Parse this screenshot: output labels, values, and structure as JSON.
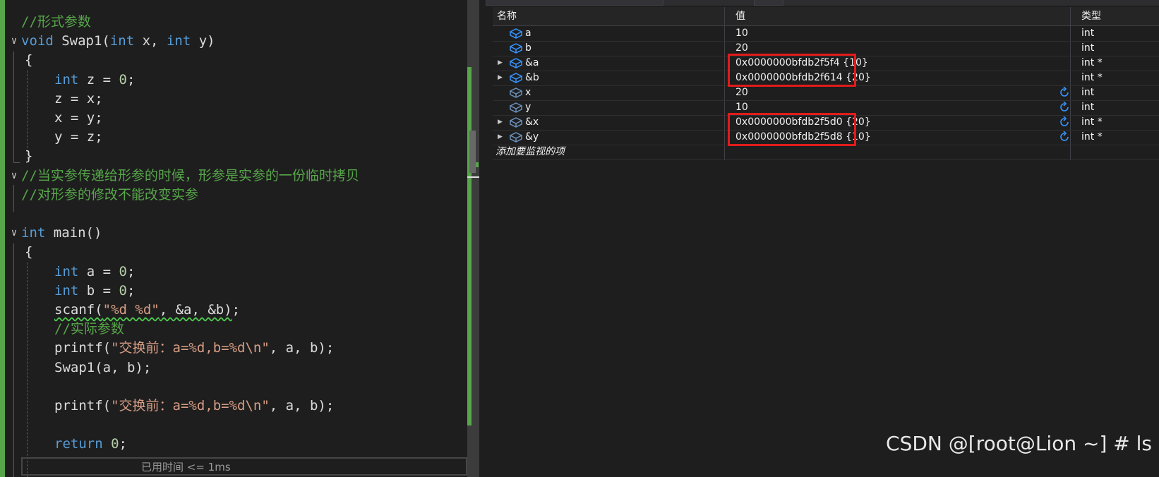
{
  "editor": {
    "lines": [
      {
        "tokens": [
          {
            "t": "//形式参数",
            "c": "cm"
          }
        ]
      },
      {
        "tokens": [
          {
            "t": "void",
            "c": "kw"
          },
          {
            "t": " Swap1(",
            "c": "pl"
          },
          {
            "t": "int",
            "c": "kw"
          },
          {
            "t": " x, ",
            "c": "pl"
          },
          {
            "t": "int",
            "c": "kw"
          },
          {
            "t": " y)",
            "c": "pl"
          }
        ]
      },
      {
        "tokens": [
          {
            "t": "{",
            "c": "pl"
          }
        ]
      },
      {
        "tokens": [
          {
            "t": "int",
            "c": "kw"
          },
          {
            "t": " z = ",
            "c": "pl"
          },
          {
            "t": "0",
            "c": "nm"
          },
          {
            "t": ";",
            "c": "pl"
          }
        ]
      },
      {
        "tokens": [
          {
            "t": "z = x;",
            "c": "pl"
          }
        ]
      },
      {
        "tokens": [
          {
            "t": "x = y;",
            "c": "pl"
          }
        ]
      },
      {
        "tokens": [
          {
            "t": "y = z;",
            "c": "pl"
          }
        ]
      },
      {
        "tokens": [
          {
            "t": "}",
            "c": "pl"
          }
        ]
      },
      {
        "tokens": [
          {
            "t": "//当实参传递给形参的时候，形参是实参的一份临时拷贝",
            "c": "cm"
          }
        ]
      },
      {
        "tokens": [
          {
            "t": "//对形参的修改不能改变实参",
            "c": "cm"
          }
        ]
      },
      {
        "tokens": []
      },
      {
        "tokens": [
          {
            "t": "int",
            "c": "kw"
          },
          {
            "t": " main()",
            "c": "pl"
          }
        ]
      },
      {
        "tokens": [
          {
            "t": "{",
            "c": "pl"
          }
        ]
      },
      {
        "tokens": [
          {
            "t": "int",
            "c": "kw"
          },
          {
            "t": " a = ",
            "c": "pl"
          },
          {
            "t": "0",
            "c": "nm"
          },
          {
            "t": ";",
            "c": "pl"
          }
        ]
      },
      {
        "tokens": [
          {
            "t": "int",
            "c": "kw"
          },
          {
            "t": " b = ",
            "c": "pl"
          },
          {
            "t": "0",
            "c": "nm"
          },
          {
            "t": ";",
            "c": "pl"
          }
        ]
      },
      {
        "tokens": [
          {
            "t": "scanf(",
            "c": "pl squiggle"
          },
          {
            "t": "\"%d %d\"",
            "c": "st squiggle"
          },
          {
            "t": ", &a, &b)",
            "c": "pl squiggle"
          },
          {
            "t": ";",
            "c": "pl"
          }
        ]
      },
      {
        "tokens": [
          {
            "t": "//实际参数",
            "c": "cm"
          }
        ]
      },
      {
        "tokens": [
          {
            "t": "printf(",
            "c": "pl"
          },
          {
            "t": "\"交换前：a=%d,b=%d\\n\"",
            "c": "st"
          },
          {
            "t": ", a, b);",
            "c": "pl"
          }
        ]
      },
      {
        "tokens": [
          {
            "t": "Swap1(a, b);",
            "c": "pl"
          }
        ]
      },
      {
        "tokens": []
      },
      {
        "tokens": [
          {
            "t": "printf(",
            "c": "pl"
          },
          {
            "t": "\"交换前：a=%d,b=%d\\n\"",
            "c": "st"
          },
          {
            "t": ", a, b);",
            "c": "pl"
          }
        ]
      },
      {
        "tokens": []
      },
      {
        "tokens": [
          {
            "t": "return",
            "c": "kw"
          },
          {
            "t": " ",
            "c": "pl"
          },
          {
            "t": "0",
            "c": "nm"
          },
          {
            "t": ";",
            "c": "pl"
          }
        ]
      }
    ],
    "elapsed_hint": "已用时间 <= 1ms"
  },
  "watch": {
    "columns": {
      "name": "名称",
      "value": "值",
      "type": "类型"
    },
    "rows": [
      {
        "name": "a",
        "value": "10",
        "type": "int",
        "expandable": false,
        "stale": false,
        "refresh": false,
        "highlight": false
      },
      {
        "name": "b",
        "value": "20",
        "type": "int",
        "expandable": false,
        "stale": false,
        "refresh": false,
        "highlight": false
      },
      {
        "name": "&a",
        "value": "0x0000000bfdb2f5f4 {10}",
        "type": "int *",
        "expandable": true,
        "stale": false,
        "refresh": false,
        "highlight": true
      },
      {
        "name": "&b",
        "value": "0x0000000bfdb2f614 {20}",
        "type": "int *",
        "expandable": true,
        "stale": false,
        "refresh": false,
        "highlight": true
      },
      {
        "name": "x",
        "value": "20",
        "type": "int",
        "expandable": false,
        "stale": true,
        "refresh": true,
        "highlight": false
      },
      {
        "name": "y",
        "value": "10",
        "type": "int",
        "expandable": false,
        "stale": true,
        "refresh": true,
        "highlight": false
      },
      {
        "name": "&x",
        "value": "0x0000000bfdb2f5d0 {20}",
        "type": "int *",
        "expandable": true,
        "stale": true,
        "refresh": true,
        "highlight": true
      },
      {
        "name": "&y",
        "value": "0x0000000bfdb2f5d8 {10}",
        "type": "int *",
        "expandable": true,
        "stale": true,
        "refresh": true,
        "highlight": true
      }
    ],
    "add_watch": "添加要监视的项",
    "highlight_color": "#e21b1b",
    "icon_color": "#3794ff",
    "icon_stale_color": "#6a8fb8"
  },
  "watermark": "CSDN @[root@Lion ~] # ls"
}
